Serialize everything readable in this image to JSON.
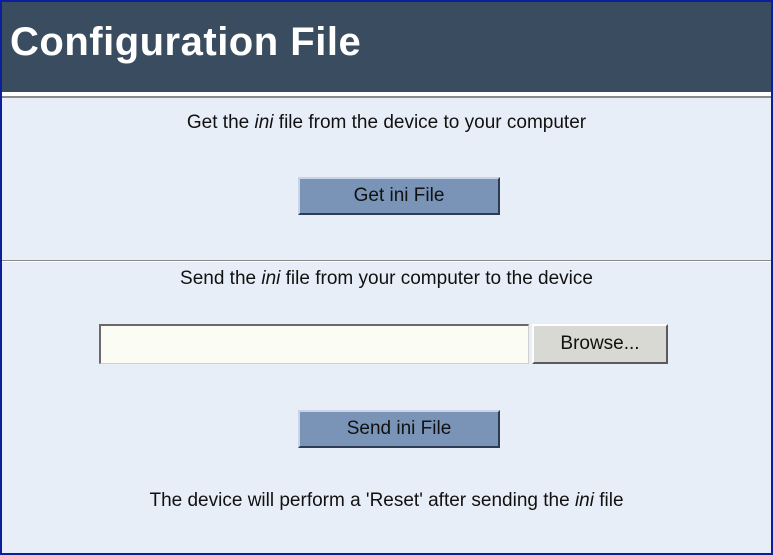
{
  "header": {
    "title": "Configuration File"
  },
  "get_section": {
    "text_before": "Get the ",
    "text_italic": "ini",
    "text_after": " file from the device to your computer",
    "button_label": "Get ini File"
  },
  "send_section": {
    "text_before": "Send the ",
    "text_italic": "ini",
    "text_after": " file from your computer to the device",
    "file_input_value": "",
    "browse_label": "Browse...",
    "button_label": "Send ini File",
    "note_before": "The device will perform a 'Reset' after sending the ",
    "note_italic": "ini",
    "note_after": " file"
  },
  "colors": {
    "header_bg": "#3a4d60",
    "page_bg": "#e8eef8",
    "button_bg": "#7a94b8",
    "frame_border": "#0b1f9c"
  }
}
